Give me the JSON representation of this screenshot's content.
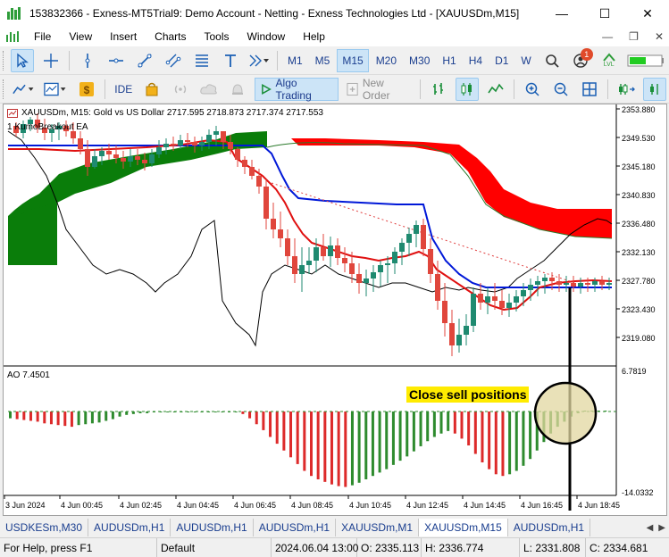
{
  "window": {
    "title": "153832366 - Exness-MT5Trial9: Demo Account - Netting - Exness Technologies Ltd - [XAUUSDm,M15]",
    "minimize_glyph": "—",
    "maximize_glyph": "☐",
    "close_glyph": "✕"
  },
  "menu": {
    "items": [
      "File",
      "View",
      "Insert",
      "Charts",
      "Tools",
      "Window",
      "Help"
    ],
    "right_glyphs": [
      "—",
      "❐",
      "✕"
    ]
  },
  "toolbar1": {
    "timeframes": [
      "M1",
      "M5",
      "M15",
      "M20",
      "M30",
      "H1",
      "H4",
      "D1",
      "W"
    ],
    "active_timeframe": "M15",
    "notification_count": "1",
    "lvl_label": "LVL"
  },
  "toolbar2": {
    "ide_label": "IDE",
    "algo_trading_label": "Algo Trading",
    "new_order_label": "New Order"
  },
  "chart": {
    "header": "XAUUSDm, M15:  Gold vs US Dollar  2717.595 2718.873 2717.374 2717.553",
    "ea_label": "1  KumoBreakout EA",
    "ao_label": "AO 7.4501",
    "annotation": "Close sell positions",
    "price_labels": [
      "2353.880",
      "2349.530",
      "2345.180",
      "2340.830",
      "2336.480",
      "2332.130",
      "2327.780",
      "2323.430",
      "2319.080"
    ],
    "ao_labels": [
      "6.7819",
      "-14.0332"
    ],
    "time_labels": [
      "3 Jun 2024",
      "4 Jun 00:45",
      "4 Jun 02:45",
      "4 Jun 04:45",
      "4 Jun 06:45",
      "4 Jun 08:45",
      "4 Jun 10:45",
      "4 Jun 12:45",
      "4 Jun 14:45",
      "4 Jun 16:45",
      "4 Jun 18:45"
    ],
    "colors": {
      "bull": "#1f8a70",
      "bear": "#e0463c",
      "kumo_bull": "#0a7d0a",
      "kumo_bear": "#ff0000",
      "kijun": "#0018d8",
      "tenkan": "#e01010",
      "chikou": "#000000",
      "ao_up": "#2e8b2e",
      "ao_down": "#dd2a2a",
      "annotation_bg": "#ffeb00"
    }
  },
  "tabs": {
    "items": [
      "USDKESm,M30",
      "AUDUSDm,H1",
      "AUDUSDm,H1",
      "AUDUSDm,H1",
      "XAUUSDm,M1",
      "XAUUSDm,M15",
      "AUDUSDm,H1"
    ],
    "active_index": 5
  },
  "status": {
    "help": "For Help, press F1",
    "profile": "Default",
    "datetime": "2024.06.04 13:00",
    "open": "O: 2335.113",
    "high": "H: 2336.774",
    "low": "L: 2331.808",
    "close": "C: 2334.681"
  }
}
